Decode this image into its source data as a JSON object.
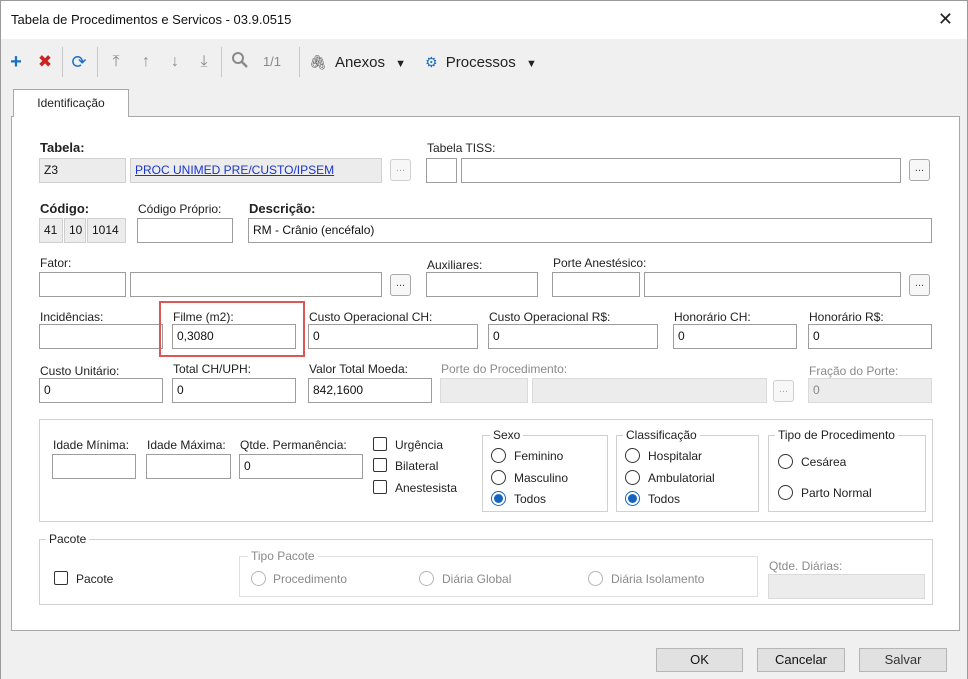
{
  "window": {
    "title": "Tabela de Procedimentos e Servicos - 03.9.0515"
  },
  "toolbar": {
    "page_indicator": "1/1",
    "anexos_label": "Anexos",
    "processos_label": "Processos"
  },
  "tab": {
    "label": "Identificação"
  },
  "tabela": {
    "label": "Tabela:",
    "code": "Z3",
    "name": "PROC UNIMED PRE/CUSTO/IPSEM"
  },
  "tabela_tiss": {
    "label": "Tabela TISS:",
    "code": "",
    "value": ""
  },
  "codigo": {
    "label": "Código:",
    "p1": "41",
    "p2": "10",
    "p3": "1014"
  },
  "codigo_proprio": {
    "label": "Código Próprio:",
    "value": ""
  },
  "descricao": {
    "label": "Descrição:",
    "value": "RM - Crânio (encéfalo)"
  },
  "fator": {
    "label": "Fator:",
    "code": "",
    "value": ""
  },
  "auxiliares": {
    "label": "Auxiliares:",
    "value": ""
  },
  "porte_anestesico": {
    "label": "Porte Anestésico:",
    "code": "",
    "value": ""
  },
  "incidencias": {
    "label": "Incidências:",
    "value": ""
  },
  "filme": {
    "label": "Filme (m2):",
    "value": "0,3080"
  },
  "custo_oper_ch": {
    "label": "Custo Operacional CH:",
    "value": "0"
  },
  "custo_oper_rs": {
    "label": "Custo Operacional R$:",
    "value": "0"
  },
  "honorario_ch": {
    "label": "Honorário CH:",
    "value": "0"
  },
  "honorario_rs": {
    "label": "Honorário R$:",
    "value": "0"
  },
  "custo_unitario": {
    "label": "Custo Unitário:",
    "value": "0"
  },
  "total_ch": {
    "label": "Total CH/UPH:",
    "value": "0"
  },
  "valor_total": {
    "label": "Valor Total Moeda:",
    "value": "842,1600"
  },
  "porte_procedimento": {
    "label": "Porte do Procedimento:",
    "code": "",
    "value": ""
  },
  "fracao_porte": {
    "label": "Fração do Porte:",
    "value": "0"
  },
  "idade_min": {
    "label": "Idade Mínima:",
    "value": ""
  },
  "idade_max": {
    "label": "Idade Máxima:",
    "value": ""
  },
  "qtde_perm": {
    "label": "Qtde. Permanência:",
    "value": "0"
  },
  "checks": {
    "urgencia": "Urgência",
    "bilateral": "Bilateral",
    "anestesista": "Anestesista"
  },
  "sexo": {
    "title": "Sexo",
    "opt1": "Feminino",
    "opt2": "Masculino",
    "opt3": "Todos",
    "selected": "Todos"
  },
  "classificacao": {
    "title": "Classificação",
    "opt1": "Hospitalar",
    "opt2": "Ambulatorial",
    "opt3": "Todos",
    "selected": "Todos"
  },
  "tipo_proc": {
    "title": "Tipo de Procedimento",
    "opt1": "Cesárea",
    "opt2": "Parto Normal"
  },
  "pacote": {
    "title": "Pacote",
    "check_label": "Pacote",
    "tipo_title": "Tipo Pacote",
    "opt1": "Procedimento",
    "opt2": "Diária Global",
    "opt3": "Diária Isolamento",
    "qtde_label": "Qtde. Diárias:",
    "qtde_value": ""
  },
  "footer": {
    "ok": "OK",
    "cancelar": "Cancelar",
    "salvar": "Salvar"
  },
  "colors": {
    "accent": "#1565c0",
    "link": "#1a35c8",
    "add": "#1a6fc4",
    "delete": "#cc2222",
    "highlight": "#e05555"
  },
  "icons": [
    "add-icon",
    "delete-icon",
    "refresh-icon",
    "first-icon",
    "up-icon",
    "down-icon",
    "last-icon",
    "search-icon",
    "paperclip-icon",
    "gear-icon",
    "chevron-down-icon",
    "close-icon"
  ]
}
